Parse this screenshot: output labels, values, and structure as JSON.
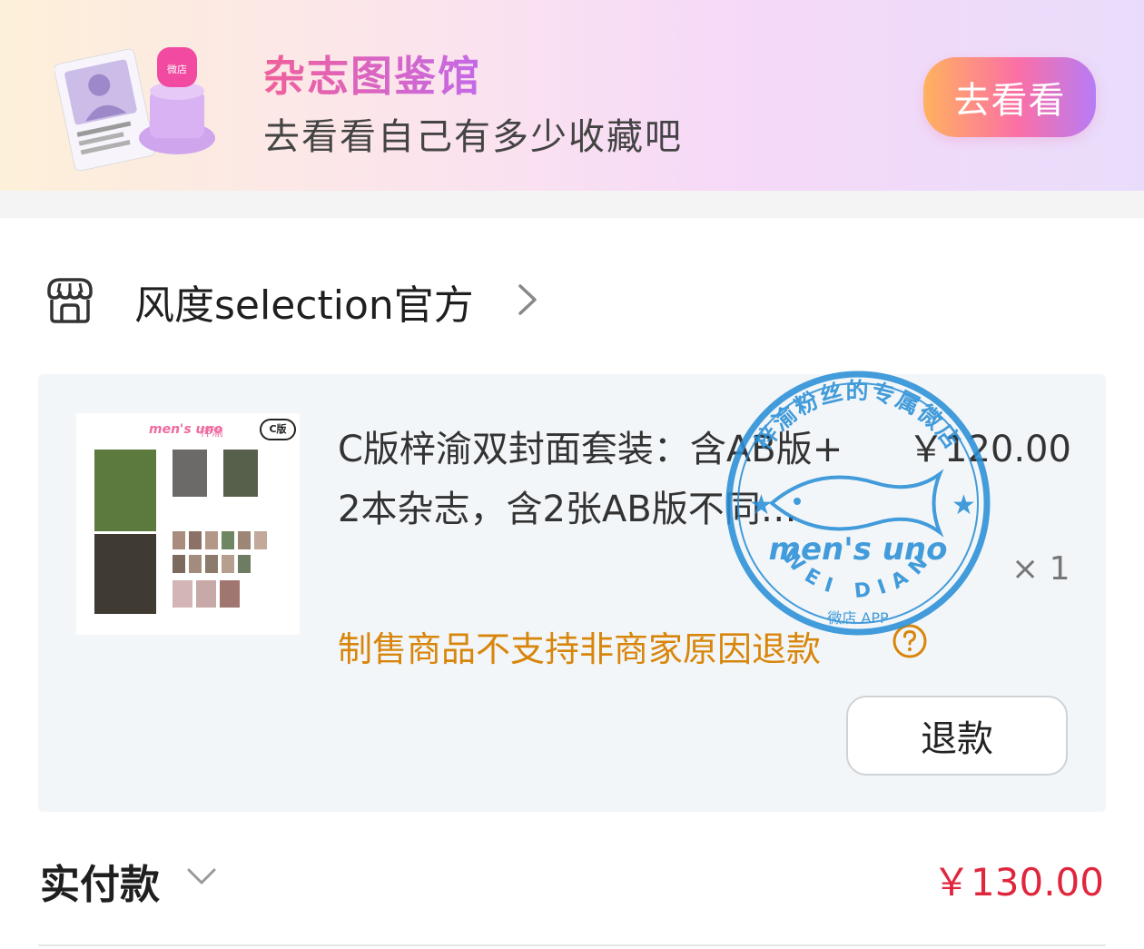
{
  "banner": {
    "title": "杂志图鉴馆",
    "subtitle": "去看看自己有多少收藏吧",
    "button_label": "去看看",
    "stamp_icon_text": "微店"
  },
  "shop": {
    "name": "风度selection官方",
    "icon": "shop-icon"
  },
  "product": {
    "title": "C版梓渝双封面套装：含AB版+",
    "subtitle": "2本杂志，含2张AB版不同…",
    "price": "￥120.00",
    "quantity": "× 1",
    "refund_note": "制售商品不支持非商家原因退款",
    "refund_button": "退款",
    "thumbnail": {
      "brand": "men's uno",
      "name": "梓渝",
      "version": "C版"
    }
  },
  "stamp": {
    "top_text": "梓渝粉丝的专属微店",
    "bottom_text": "WEI DIAN",
    "app_text": "微店 APP",
    "brand": "men's uno"
  },
  "total": {
    "label": "实付款",
    "value": "￥130.00"
  },
  "colors": {
    "price_red": "#e0263d",
    "warning_orange": "#d8860b",
    "stamp_blue": "#2a8fd6",
    "banner_pink": "#f0609a"
  }
}
